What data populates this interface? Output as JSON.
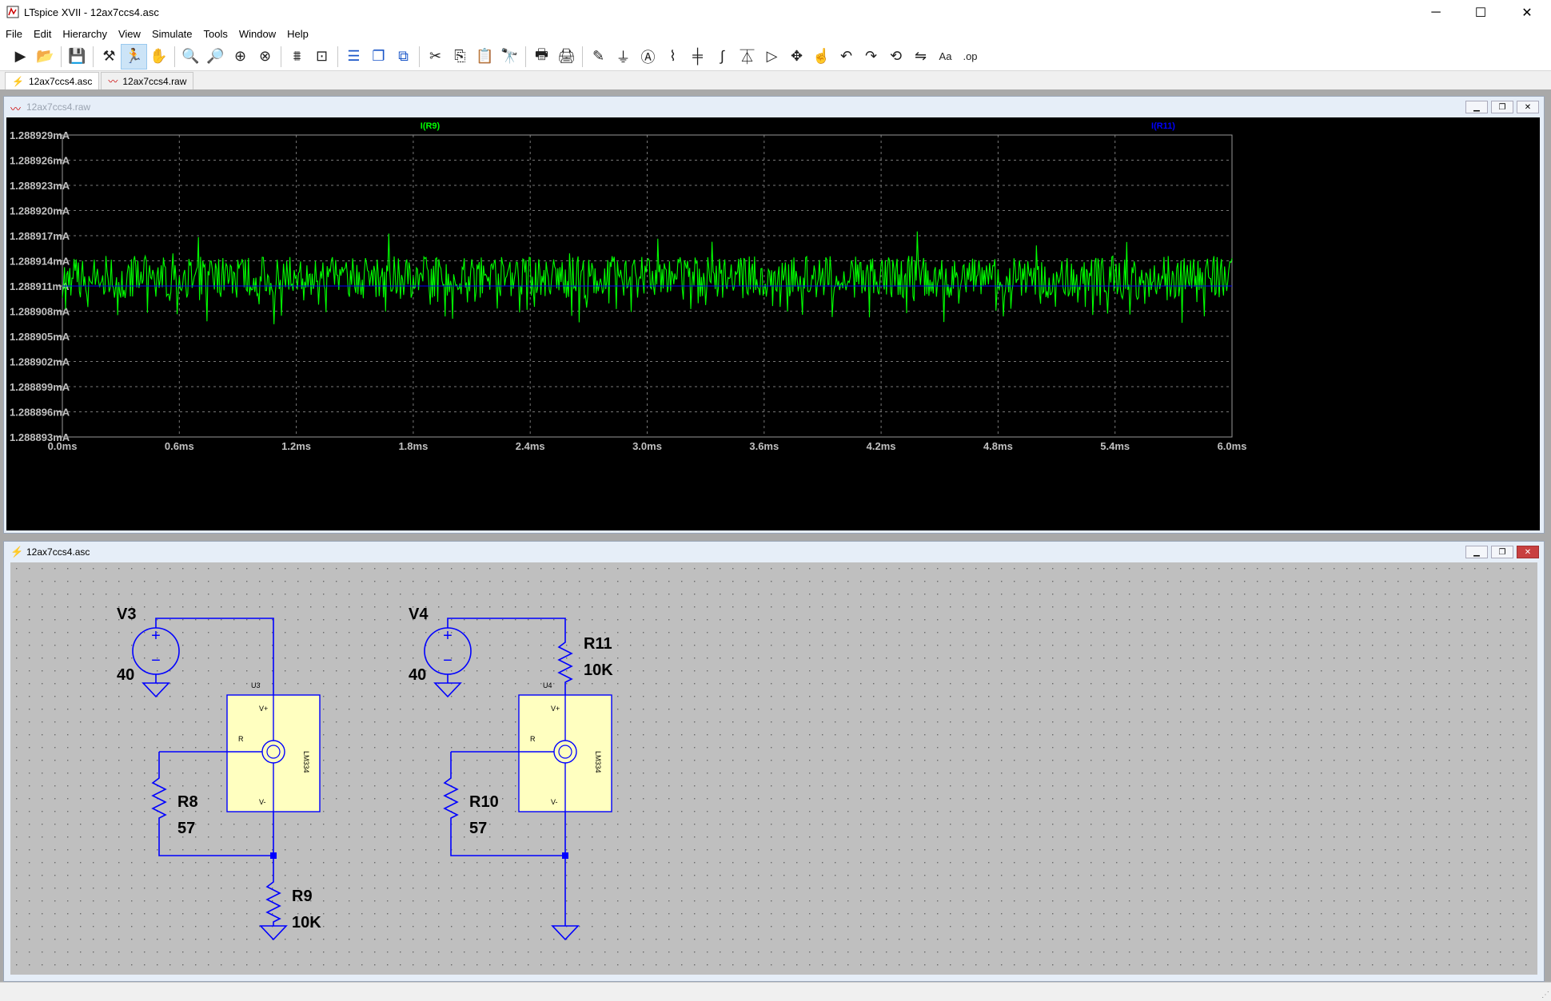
{
  "window": {
    "title": "LTspice XVII - 12ax7ccs4.asc",
    "minimize": "─",
    "maximize": "☐",
    "close": "✕"
  },
  "menu": [
    "File",
    "Edit",
    "Hierarchy",
    "View",
    "Simulate",
    "Tools",
    "Window",
    "Help"
  ],
  "toolbar": [
    {
      "icon": "run-icon",
      "glyph": "▶"
    },
    {
      "icon": "open-folder-icon",
      "glyph": "📂"
    },
    {
      "sep": true
    },
    {
      "icon": "save-icon",
      "glyph": "💾"
    },
    {
      "sep": true
    },
    {
      "icon": "control-panel-icon",
      "glyph": "⚒"
    },
    {
      "icon": "run-probe-icon",
      "glyph": "🏃",
      "active": true
    },
    {
      "icon": "pan-hand-icon",
      "glyph": "✋"
    },
    {
      "sep": true
    },
    {
      "icon": "zoom-in-icon",
      "glyph": "🔍"
    },
    {
      "icon": "zoom-out-icon",
      "glyph": "🔎"
    },
    {
      "icon": "zoom-fit-icon",
      "glyph": "⊕"
    },
    {
      "icon": "zoom-cancel-icon",
      "glyph": "⊗"
    },
    {
      "sep": true
    },
    {
      "icon": "autorange-icon",
      "glyph": "⩩"
    },
    {
      "icon": "autorange-off-icon",
      "glyph": "⊡"
    },
    {
      "sep": true
    },
    {
      "icon": "tile-horizontal-icon",
      "glyph": "☰",
      "blue": true
    },
    {
      "icon": "cascade-icon",
      "glyph": "❐",
      "blue": true
    },
    {
      "icon": "close-all-icon",
      "glyph": "⧉",
      "blue": true
    },
    {
      "sep": true
    },
    {
      "icon": "cut-icon",
      "glyph": "✂"
    },
    {
      "icon": "copy-icon",
      "glyph": "⎘"
    },
    {
      "icon": "paste-icon",
      "glyph": "📋"
    },
    {
      "icon": "find-icon",
      "glyph": "🔭"
    },
    {
      "sep": true
    },
    {
      "icon": "print-icon",
      "glyph": "🖶"
    },
    {
      "icon": "print-setup-icon",
      "glyph": "🖨"
    },
    {
      "sep": true
    },
    {
      "icon": "draw-wire-icon",
      "glyph": "✎"
    },
    {
      "icon": "ground-icon",
      "glyph": "⏚"
    },
    {
      "icon": "label-net-icon",
      "glyph": "Ⓐ"
    },
    {
      "icon": "resistor-icon",
      "glyph": "⌇"
    },
    {
      "icon": "capacitor-icon",
      "glyph": "╪"
    },
    {
      "icon": "inductor-icon",
      "glyph": "∫"
    },
    {
      "icon": "diode-icon",
      "glyph": "⏄"
    },
    {
      "icon": "component-icon",
      "glyph": "▷"
    },
    {
      "icon": "move-icon",
      "glyph": "✥"
    },
    {
      "icon": "drag-icon",
      "glyph": "☝"
    },
    {
      "icon": "undo-icon",
      "glyph": "↶"
    },
    {
      "icon": "redo-icon",
      "glyph": "↷"
    },
    {
      "icon": "rotate-icon",
      "glyph": "⟲"
    },
    {
      "icon": "mirror-icon",
      "glyph": "⇋"
    },
    {
      "icon": "text-icon",
      "glyph": "Aa"
    },
    {
      "icon": "spice-directive-icon",
      "glyph": ".op"
    }
  ],
  "tabs": [
    {
      "label": "12ax7ccs4.asc",
      "icon": "⚡",
      "active": true
    },
    {
      "label": "12ax7ccs4.raw",
      "icon": "〰",
      "active": false
    }
  ],
  "waveform": {
    "title": "12ax7ccs4.raw",
    "background": "#000000",
    "grid_color": "#777777",
    "axis_text_color": "#c0c0c0"
  },
  "chart_data": {
    "type": "line",
    "title": "",
    "xlabel": "",
    "ylabel": "",
    "x_ticks": [
      "0.0ms",
      "0.6ms",
      "1.2ms",
      "1.8ms",
      "2.4ms",
      "3.0ms",
      "3.6ms",
      "4.2ms",
      "4.8ms",
      "5.4ms",
      "6.0ms"
    ],
    "y_ticks": [
      "1.288929mA",
      "1.288926mA",
      "1.288923mA",
      "1.288920mA",
      "1.288917mA",
      "1.288914mA",
      "1.288911mA",
      "1.288908mA",
      "1.288905mA",
      "1.288902mA",
      "1.288899mA",
      "1.288896mA",
      "1.288893mA"
    ],
    "xlim": [
      0,
      6.0
    ],
    "ylim": [
      1.288893,
      1.288929
    ],
    "grid": true,
    "series": [
      {
        "name": "I(R9)",
        "color": "#00ff00",
        "mean": 1.2889121,
        "noise_amplitude": 2.5e-06,
        "shape": "noisy-flat"
      },
      {
        "name": "I(R11)",
        "color": "#0000ff",
        "mean": 1.288911,
        "noise_amplitude": 0,
        "shape": "flat"
      }
    ]
  },
  "schematic": {
    "title": "12ax7ccs4.asc",
    "background": "#bfbfbf",
    "wire_color": "#0000ff",
    "labels": {
      "V3": "V3",
      "V3_val": "40",
      "U3": "U3",
      "R8": "R8",
      "R8_val": "57",
      "R9": "R9",
      "R9_val": "10K",
      "V4": "V4",
      "V4_val": "40",
      "U4": "U4",
      "R10": "R10",
      "R10_val": "57",
      "R11": "R11",
      "R11_val": "10K",
      "pin_vplus": "V+",
      "pin_r": "R",
      "pin_vminus": "V-",
      "ic_name": "LM334"
    }
  }
}
